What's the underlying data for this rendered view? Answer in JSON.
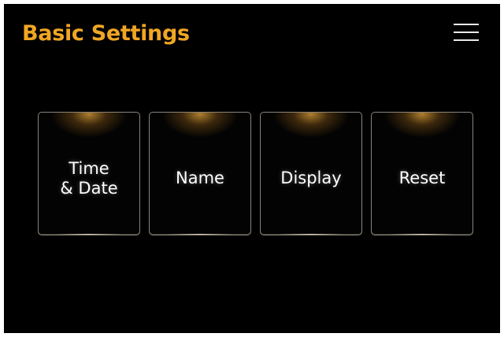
{
  "header": {
    "title": "Basic Settings",
    "menu_icon": "hamburger-menu-icon"
  },
  "tiles": [
    {
      "label": "Time\n& Date"
    },
    {
      "label": "Name"
    },
    {
      "label": "Display"
    },
    {
      "label": "Reset"
    }
  ],
  "colors": {
    "background": "#000000",
    "title": "#f0a623",
    "tile_glow": "#e8a83c",
    "tile_border": "#8a8378",
    "text": "#ffffff"
  }
}
